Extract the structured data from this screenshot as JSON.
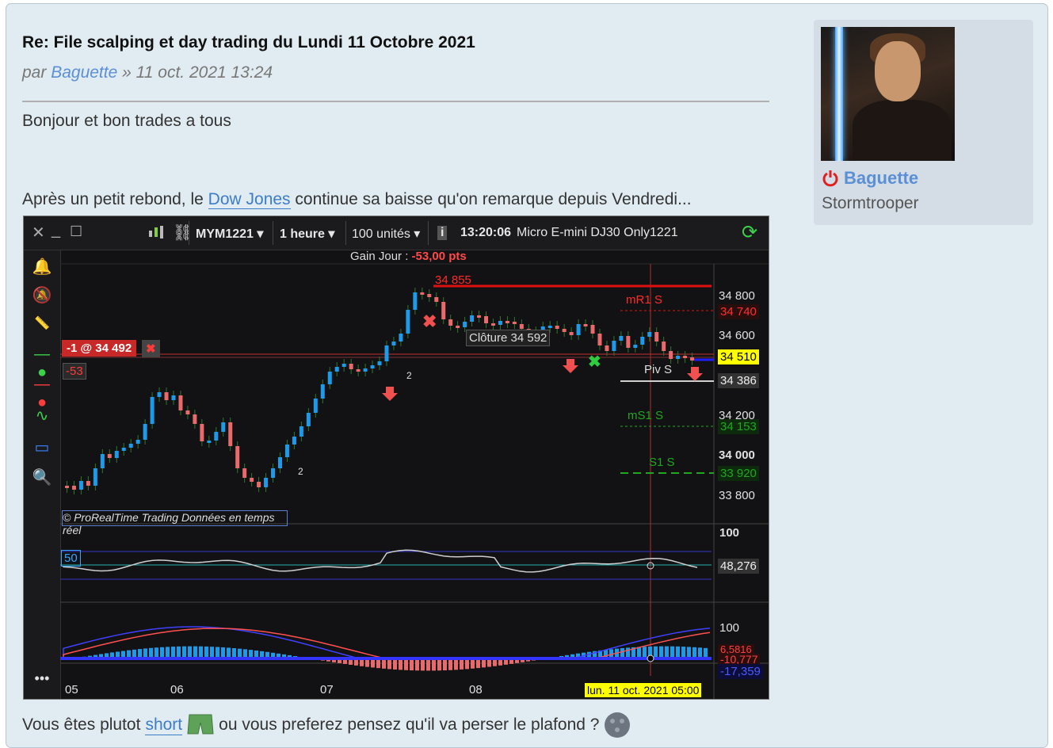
{
  "post": {
    "title": "Re: File scalping et day trading du Lundi 11 Octobre 2021",
    "by_prefix": "par",
    "author": "Baguette",
    "date": "» 11 oct. 2021 13:24",
    "greeting": "Bonjour et bon trades a tous",
    "para_before": "Après un petit rebond, le",
    "link_dow": "Dow Jones",
    "para_after": "continue sa baisse qu'on remarque depuis Vendredi...",
    "footer_before": "Vous êtes plutot",
    "link_short": "short",
    "footer_after": "ou vous preferez pensez qu'il va perser le plafond ?"
  },
  "profile": {
    "username": "Baguette",
    "rank": "Stormtrooper",
    "online_color": "#e02020"
  },
  "toolbar": {
    "symbol": "MYM1221",
    "timeframe": "1 heure",
    "units": "100 unités",
    "time": "13:20:06",
    "description": "Micro E-mini DJ30 Only1221",
    "gain_label": "Gain Jour :",
    "gain_value": "-53,00 pts"
  },
  "chart_data": {
    "type": "candlestick",
    "x_ticks": [
      "05",
      "06",
      "07",
      "08"
    ],
    "cursor_date": "lun. 11 oct. 2021 05:00",
    "y_ticks": [
      "34 800",
      "34 600",
      "34 200",
      "34 000",
      "33 800"
    ],
    "ylim": [
      33760,
      34900
    ],
    "levels": {
      "high_line": "34 855",
      "mR1": {
        "label": "mR1 S",
        "value": "34 740"
      },
      "last": "34 510",
      "piv": {
        "label": "Piv S",
        "value": "34 386"
      },
      "mS1": {
        "label": "mS1 S",
        "value": "34 153"
      },
      "S1": {
        "label": "S1 S",
        "value": "33 920"
      }
    },
    "cloture": "Clôture  34 592",
    "position": {
      "label": "-1 @ 34 492",
      "pnl": "-53"
    },
    "watermark": "© ProRealTime Trading  Données en temps réel",
    "rsi": {
      "level_label": "50",
      "top_tick": "100",
      "value": "48,276"
    },
    "macd": {
      "top_tick": "100",
      "v1": "6,5816",
      "v2": "-10,777",
      "v3": "-17,359"
    },
    "markers": [
      "2",
      "2"
    ]
  }
}
